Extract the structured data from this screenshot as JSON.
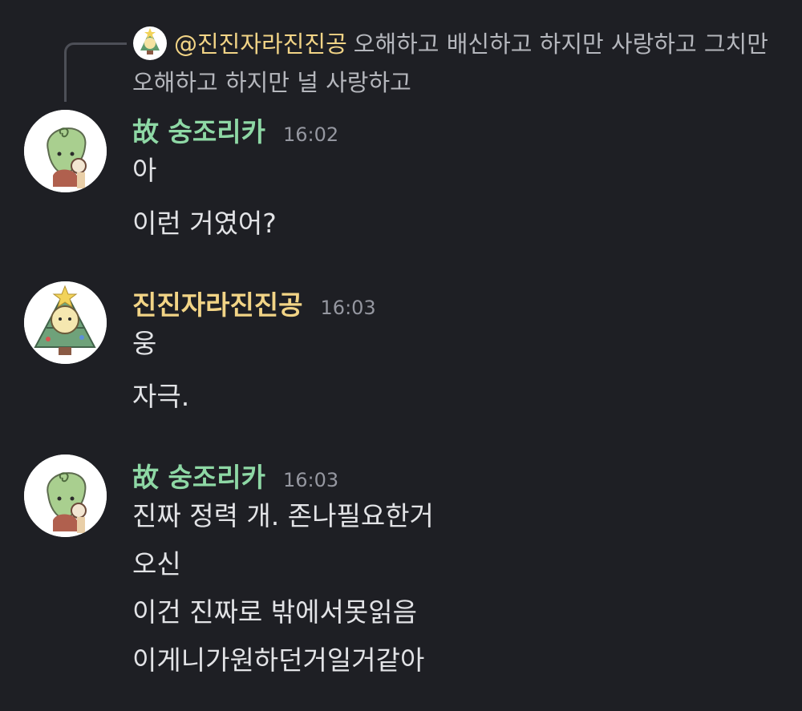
{
  "colors": {
    "background": "#1e1f24",
    "green_author": "#8ed8a5",
    "yellow_author": "#f2d486",
    "timestamp": "#9597a0",
    "reply_text": "#b5b7bd",
    "message_text": "#e2e3e6"
  },
  "reply": {
    "author": "@진진자라진진공",
    "text": "오해하고 배신하고 하지만 사랑하고 그치만 오해하고 하지만 널 사랑하고"
  },
  "messages": [
    {
      "author": "故 숭조리카",
      "time": "16:02",
      "lines": [
        "아",
        "이런 거였어?"
      ]
    },
    {
      "author": "진진자라진진공",
      "time": "16:03",
      "lines": [
        "웅",
        "자극."
      ]
    },
    {
      "author": "故 숭조리카",
      "time": "16:03",
      "lines": [
        "진짜 정력 개. 존나필요한거",
        "오신",
        "이건 진짜로 밖에서못읽음",
        "이게니가원하던거일거같아"
      ]
    }
  ]
}
